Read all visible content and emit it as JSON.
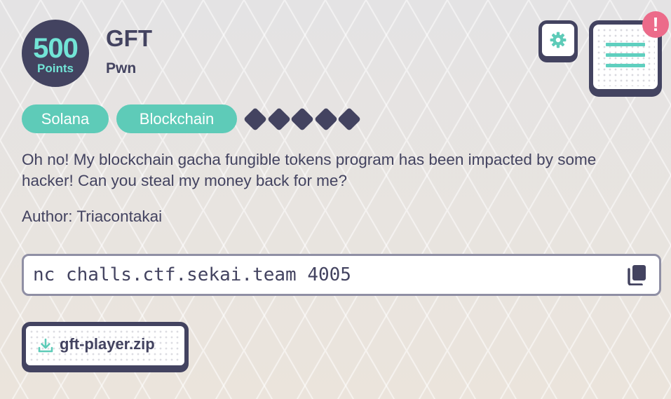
{
  "challenge": {
    "points": "500",
    "points_label": "Points",
    "title": "GFT",
    "category": "Pwn",
    "tags": [
      "Solana",
      "Blockchain"
    ],
    "difficulty": 5,
    "description": "Oh no! My blockchain gacha fungible tokens program has been impacted by some hacker! Can you steal my money back for me?",
    "author": "Author: Triacontakai",
    "connection": "nc challs.ctf.sekai.team 4005",
    "file": "gft-player.zip"
  },
  "header": {
    "alert_symbol": "!",
    "settings_icon": "gear-icon",
    "menu_icon": "menu-icon"
  },
  "colors": {
    "dark": "#434360",
    "accent": "#5ecbb8",
    "points_text": "#72e4d6",
    "alert": "#ec6b8a"
  }
}
